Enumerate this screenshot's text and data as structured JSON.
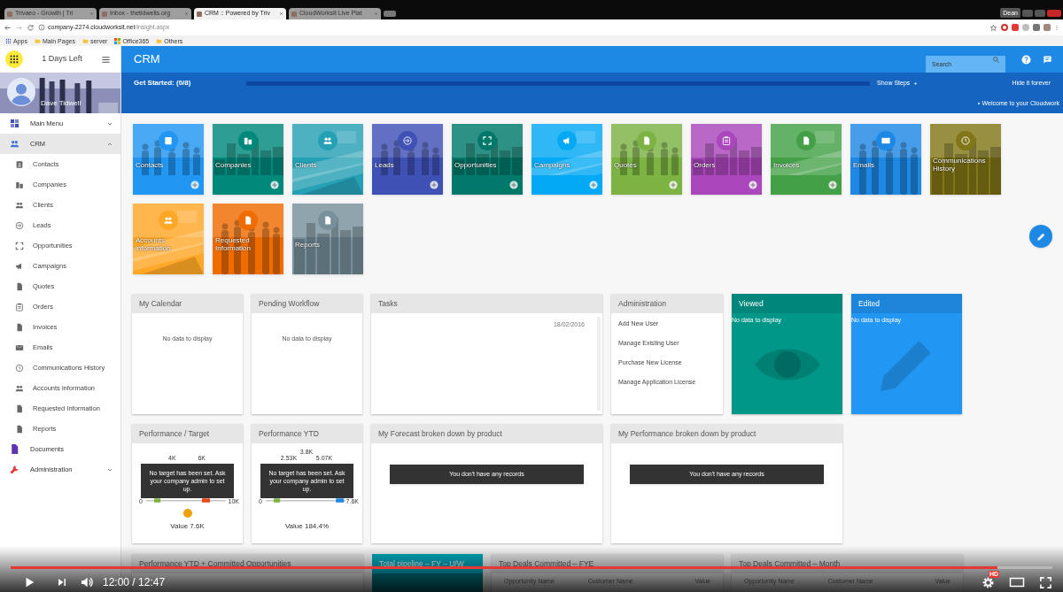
{
  "browser": {
    "tabs": [
      {
        "title": "Trivaeo - Growth | Tri",
        "selected": false
      },
      {
        "title": "Inbox - thetidwells.org",
        "selected": false
      },
      {
        "title": "CRM :: Powered by Triv",
        "selected": true
      },
      {
        "title": "CloudWorksIt Live Plat",
        "selected": false
      }
    ],
    "profile": "Dean",
    "url_host": "company-2274.cloudworksit.net",
    "url_path": "/insight.aspx",
    "bookmarks": [
      "Apps",
      "Main Pages",
      "server",
      "Office365",
      "Others"
    ]
  },
  "sidebar": {
    "trial": "1 Days Left",
    "user": "Dave Tidwell",
    "items": [
      {
        "label": "Main Menu",
        "expanded": false,
        "selected": false
      },
      {
        "label": "CRM",
        "expanded": true,
        "selected": true,
        "children": [
          {
            "label": "Contacts",
            "selected": false
          },
          {
            "label": "Companies",
            "selected": false
          },
          {
            "label": "Clients",
            "selected": false
          },
          {
            "label": "Leads",
            "selected": false
          },
          {
            "label": "Opportunities",
            "selected": false
          },
          {
            "label": "Campaigns",
            "selected": false
          },
          {
            "label": "Quotes",
            "selected": false
          },
          {
            "label": "Orders",
            "selected": false
          },
          {
            "label": "Invoices",
            "selected": false
          },
          {
            "label": "Emails",
            "selected": false
          },
          {
            "label": "Communications History",
            "selected": false
          },
          {
            "label": "Accounts information",
            "selected": false
          },
          {
            "label": "Requested Information",
            "selected": false
          },
          {
            "label": "Reports",
            "selected": false
          }
        ]
      },
      {
        "label": "Documents",
        "selected": false
      },
      {
        "label": "Administration",
        "expanded": false,
        "selected": false
      }
    ]
  },
  "header": {
    "title": "CRM",
    "search": {
      "placeholder": "Search"
    }
  },
  "get_started": {
    "label": "Get Started: (0/8)",
    "level": 0,
    "show_steps": "Show Steps",
    "hide": "Hide it forever",
    "welcome": "Welcome to your Cloudwork"
  },
  "tiles": [
    {
      "label": "Contacts",
      "color": "#2196f3",
      "add": true
    },
    {
      "label": "Companies",
      "color": "#00897b",
      "add": true
    },
    {
      "label": "Clients",
      "color": "#26a0b5",
      "add": false
    },
    {
      "label": "Leads",
      "color": "#3f51b5",
      "add": true
    },
    {
      "label": "Opportunities",
      "color": "#00796b",
      "add": true
    },
    {
      "label": "Campaigns",
      "color": "#03a9f4",
      "add": true
    },
    {
      "label": "Quotes",
      "color": "#7cb342",
      "add": true
    },
    {
      "label": "Orders",
      "color": "#ab47bc",
      "add": true
    },
    {
      "label": "Invoices",
      "color": "#43a047",
      "add": true
    },
    {
      "label": "Emails",
      "color": "#1e88e5",
      "add": false
    },
    {
      "label": "Communications History",
      "color": "#827717",
      "add": false
    },
    {
      "label": "Accounts information",
      "color": "#ffa726",
      "add": false
    },
    {
      "label": "Requested Information",
      "color": "#ef6c00",
      "add": false
    },
    {
      "label": "Reports",
      "color": "#78909c",
      "add": false
    }
  ],
  "widgets_row1": [
    {
      "kind": "message",
      "title": "My Calendar",
      "message": "No data to display"
    },
    {
      "kind": "message",
      "title": "Pending Workflow",
      "message": "No data to display"
    },
    {
      "kind": "tasks",
      "title": "Tasks",
      "date": "18/02/2016"
    },
    {
      "kind": "links",
      "title": "Administration",
      "links": [
        "Add New User",
        "Manage Existing User",
        "Purchase New License",
        "Manage Application License"
      ]
    },
    {
      "kind": "stat",
      "title": "Viewed",
      "message": "No data to display",
      "color": "#009688"
    },
    {
      "kind": "stat",
      "title": "Edited",
      "message": "No data to display",
      "color": "#2196f3"
    }
  ],
  "widgets_row2": [
    {
      "kind": "gauge",
      "title": "Performance / Target",
      "ticks": [
        "4K",
        "6K"
      ],
      "min": "0",
      "max": "10K",
      "notice": "No target has been set. Ask your company admin to set up.",
      "value": "Value 7.6K"
    },
    {
      "kind": "gauge",
      "title": "Performance YTD",
      "ticks": [
        "2.53K",
        "3.8K",
        "5.07K"
      ],
      "min": "0",
      "max": "7.6K",
      "notice": "No target has been set. Ask your company admin to set up.",
      "value": "Value 184.4%"
    },
    {
      "kind": "empty",
      "title": "My Forecast broken down by product",
      "notice": "You don't have any records"
    },
    {
      "kind": "empty",
      "title": "My Performance broken down by product",
      "notice": "You don't have any records"
    }
  ],
  "widgets_row3": [
    {
      "kind": "plain",
      "title": "Performance YTD + Committed Opportunities"
    },
    {
      "kind": "highlight",
      "title": "Total pipeline – FY – U/W"
    },
    {
      "kind": "table",
      "title": "Top Deals Committed – FYE",
      "columns": [
        "Opportunity Name",
        "Customer Name",
        "Value"
      ]
    },
    {
      "kind": "table",
      "title": "Top Deals Committed – Month",
      "columns": [
        "Opportunity Name",
        "Customer Name",
        "Value"
      ]
    }
  ],
  "player": {
    "time": "12:00 / 12:47",
    "level": 0.947,
    "hd": "HD"
  }
}
